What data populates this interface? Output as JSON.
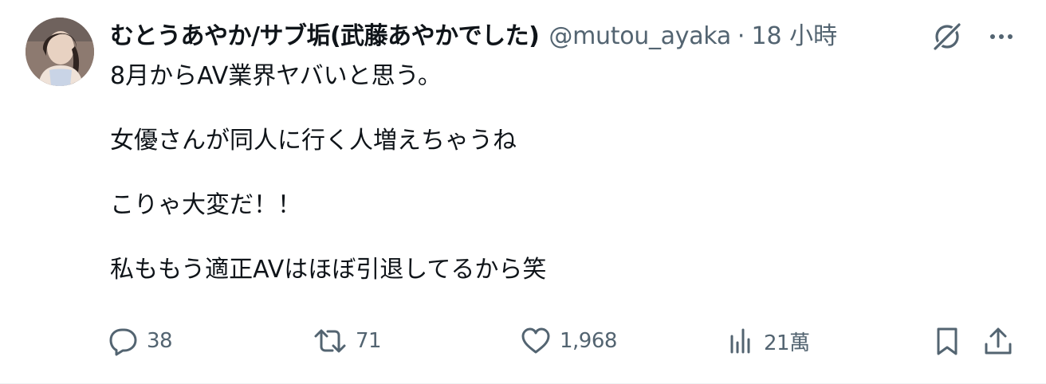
{
  "post": {
    "author": {
      "display_name": "むとうあやか/サブ垢(武藤あやかでした)",
      "handle": "@mutou_ayaka",
      "separator": "·",
      "time": "18 小時",
      "avatar_icon": "profile-photo"
    },
    "body_lines": [
      "8月からAV業界ヤバいと思う。",
      "",
      "女優さんが同人に行く人増えちゃうね",
      "",
      "こりゃ大変だ！！",
      "",
      "私ももう適正AVはほぼ引退してるから笑"
    ],
    "header_icons": {
      "grok": "grok-icon",
      "more": "more-icon"
    },
    "stats": {
      "replies": "38",
      "reposts": "71",
      "likes": "1,968",
      "views": "21萬"
    },
    "action_icons": [
      "reply-icon",
      "repost-icon",
      "like-icon",
      "views-icon",
      "bookmark-icon",
      "share-icon"
    ],
    "colors": {
      "text": "#0f1419",
      "secondary": "#536471",
      "border": "#eff3f4"
    }
  }
}
